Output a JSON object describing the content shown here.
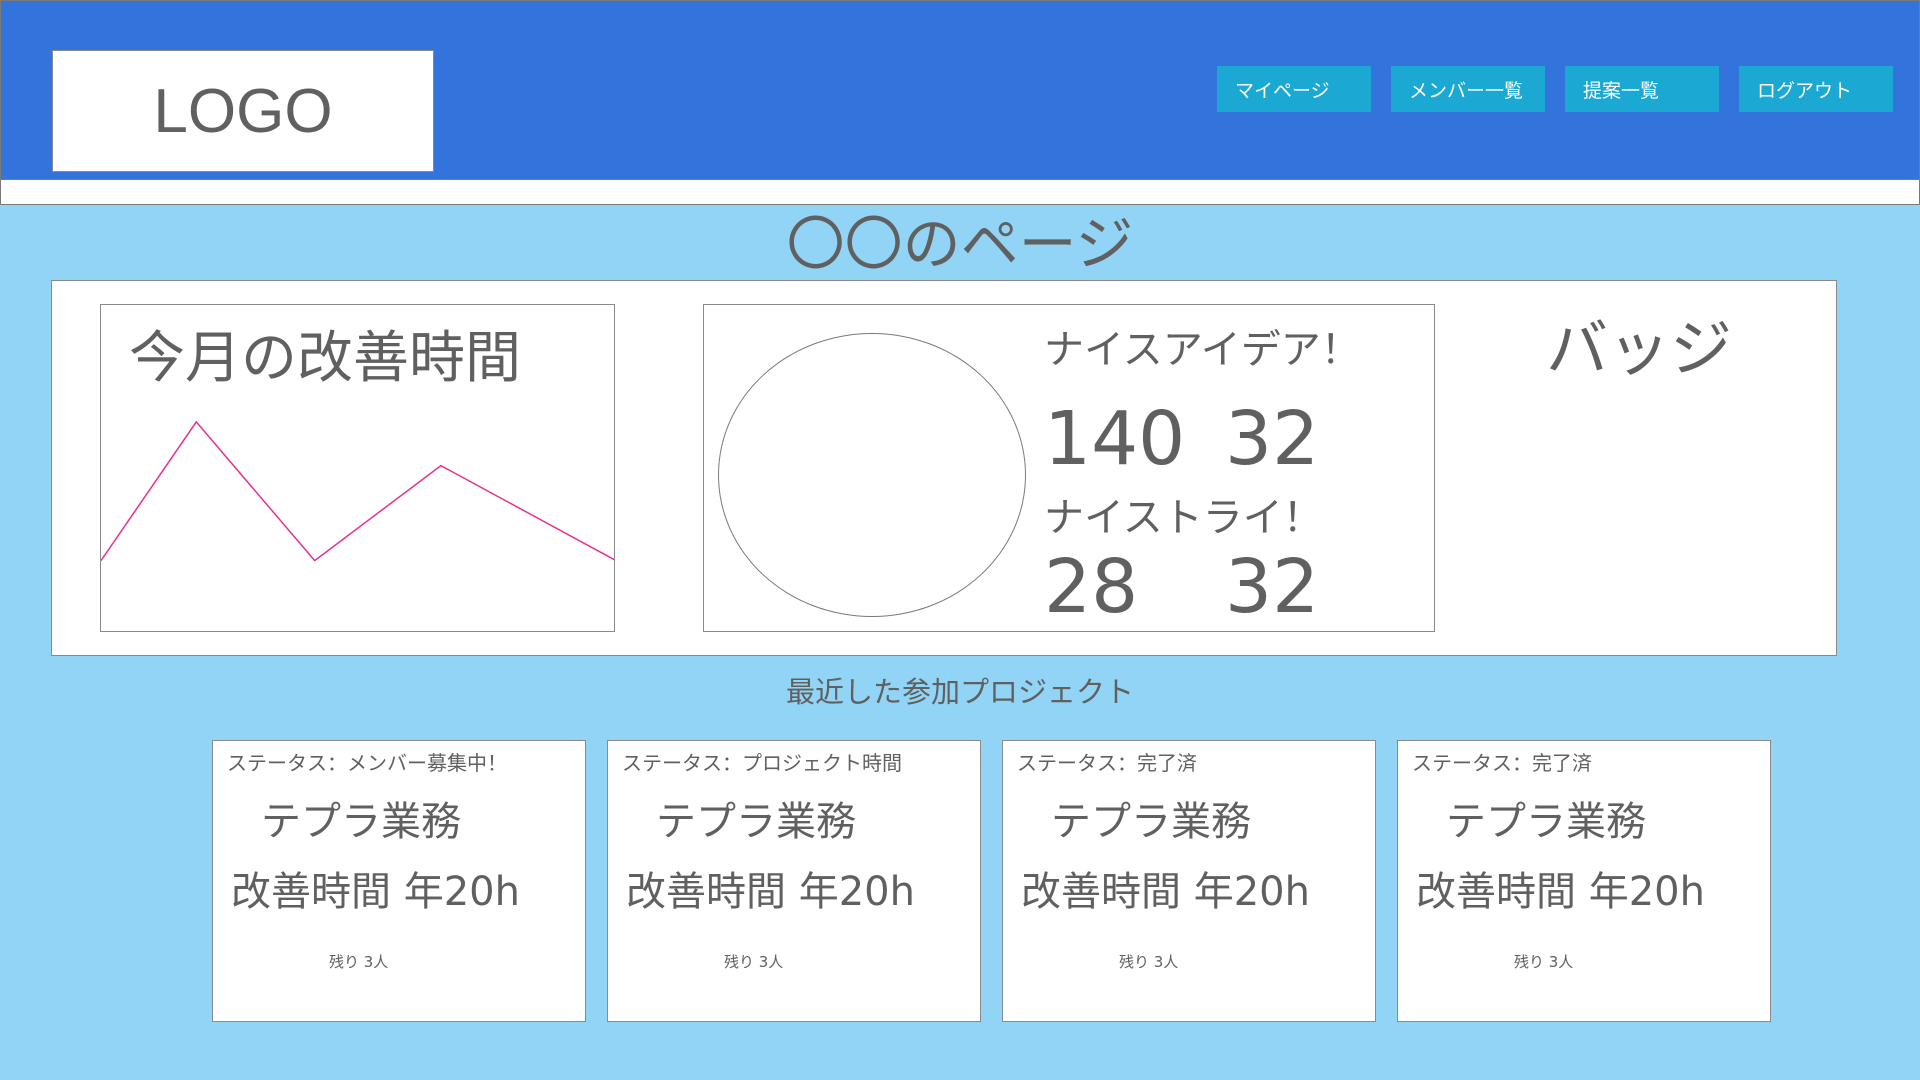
{
  "header": {
    "logo": "LOGO",
    "nav": [
      {
        "label": "マイページ"
      },
      {
        "label": "メンバー一覧"
      },
      {
        "label": "提案一覧"
      },
      {
        "label": "ログアウト"
      }
    ],
    "colors": {
      "header_bg": "#3273dc",
      "nav_bg": "#1ba8d3",
      "page_bg": "#91d4f5",
      "graph_line": "#e8318f"
    }
  },
  "page": {
    "title": "〇〇のページ"
  },
  "summary": {
    "graph": {
      "title": "今月の改善時間",
      "points": [
        {
          "x": 0,
          "y": 0.26
        },
        {
          "x": 0.185,
          "y": 0.99
        },
        {
          "x": 0.415,
          "y": 0.26
        },
        {
          "x": 0.66,
          "y": 0.76
        },
        {
          "x": 1.0,
          "y": 0.26
        }
      ]
    },
    "stats": {
      "nice_idea_label": "ナイスアイデア！",
      "nice_idea_value_1": "140",
      "nice_idea_value_2": "32",
      "nice_try_label": "ナイストライ！",
      "nice_try_value_1": "28",
      "nice_try_value_2": "32"
    },
    "badge_label": "バッジ"
  },
  "recent": {
    "title": "最近した参加プロジェクト",
    "cards": [
      {
        "status": "ステータス：メンバー募集中！",
        "name": "テプラ業務",
        "hours": "改善時間 年20h",
        "remaining": "残り 3人"
      },
      {
        "status": "ステータス：プロジェクト時間",
        "name": "テプラ業務",
        "hours": "改善時間 年20h",
        "remaining": "残り 3人"
      },
      {
        "status": "ステータス：完了済",
        "name": "テプラ業務",
        "hours": "改善時間 年20h",
        "remaining": "残り 3人"
      },
      {
        "status": "ステータス：完了済",
        "name": "テプラ業務",
        "hours": "改善時間 年20h",
        "remaining": "残り 3人"
      }
    ]
  }
}
